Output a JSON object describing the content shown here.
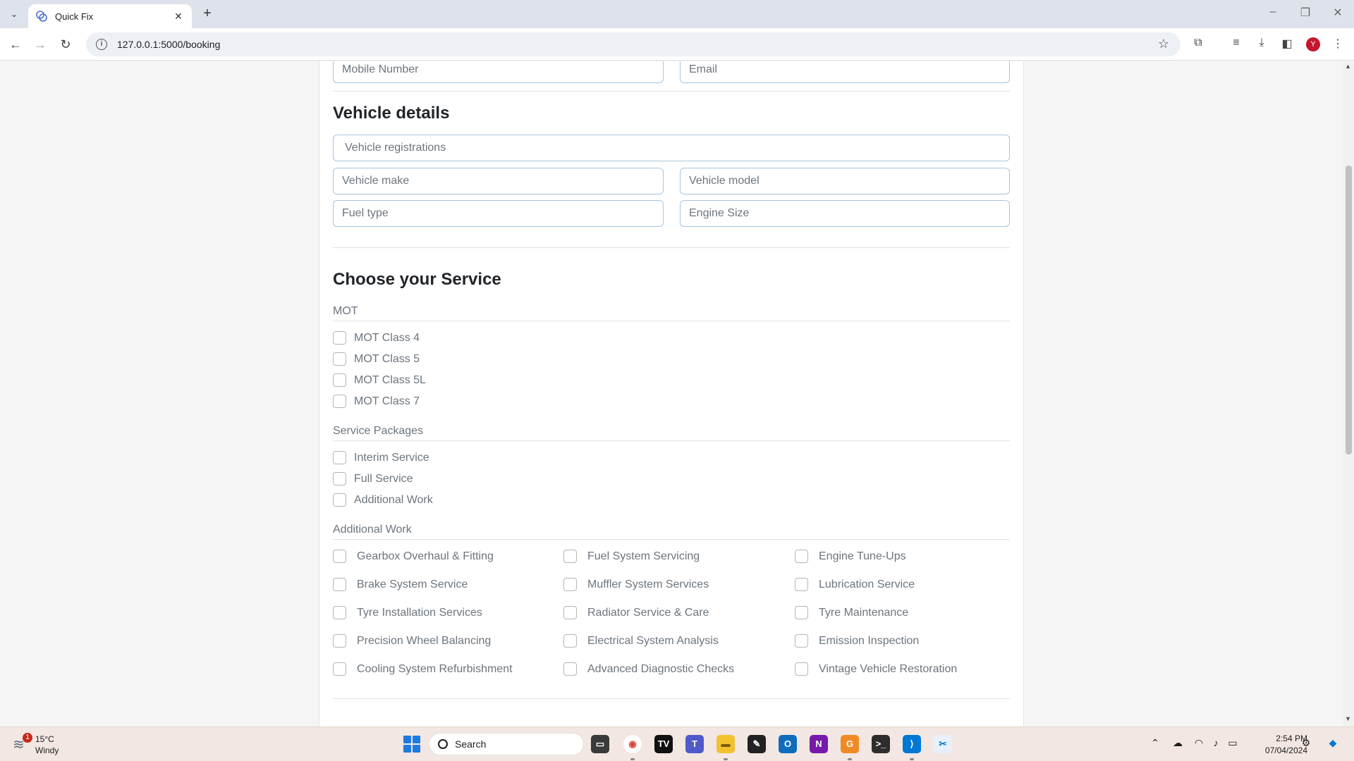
{
  "browser": {
    "tab_title": "Quick Fix",
    "url": "127.0.0.1:5000/booking",
    "avatar_letter": "Y"
  },
  "form": {
    "contact_fields": {
      "mobile_placeholder": "Mobile Number",
      "email_placeholder": "Email"
    },
    "vehicle": {
      "heading": "Vehicle details",
      "registration_placeholder": "Vehicle registrations",
      "make_placeholder": "Vehicle make",
      "model_placeholder": "Vehicle model",
      "fuel_placeholder": "Fuel type",
      "engine_placeholder": "Engine Size"
    },
    "service": {
      "heading": "Choose your Service",
      "mot_label": "MOT",
      "mot_options": [
        "MOT Class 4",
        "MOT Class 5",
        "MOT Class 5L",
        "MOT Class 7"
      ],
      "packages_label": "Service Packages",
      "package_options": [
        "Interim Service",
        "Full Service",
        "Additional Work"
      ],
      "additional_label": "Additional Work",
      "additional_options": [
        [
          "Gearbox Overhaul & Fitting",
          "Fuel System Servicing",
          "Engine Tune-Ups"
        ],
        [
          "Brake System Service",
          "Muffler System Services",
          "Lubrication Service"
        ],
        [
          "Tyre Installation Services",
          "Radiator Service & Care",
          "Tyre Maintenance"
        ],
        [
          "Precision Wheel Balancing",
          "Electrical System Analysis",
          "Emission Inspection"
        ],
        [
          "Cooling System Refurbishment",
          "Advanced Diagnostic Checks",
          "Vintage Vehicle Restoration"
        ]
      ]
    }
  },
  "taskbar": {
    "weather_badge": "1",
    "weather_temp": "15°C",
    "weather_desc": "Windy",
    "search_label": "Search",
    "time": "2:54 PM",
    "date": "07/04/2024"
  }
}
